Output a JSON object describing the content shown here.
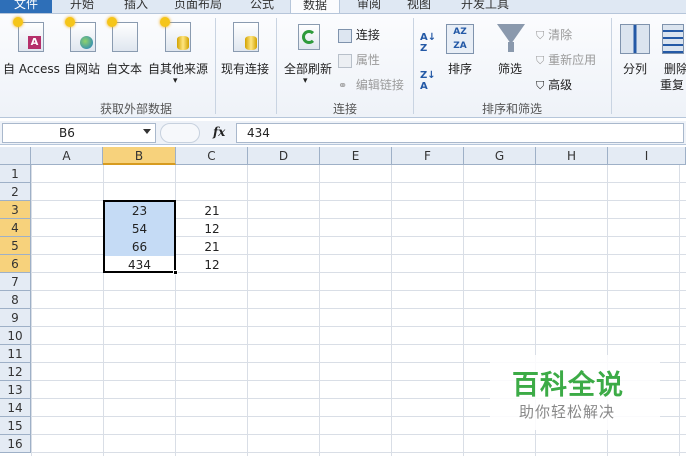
{
  "tabs": {
    "file": "文件",
    "home": "开始",
    "insert": "插入",
    "page_layout": "页面布局",
    "formulas": "公式",
    "data": "数据",
    "review": "审阅",
    "view": "视图",
    "developer": "开发工具"
  },
  "ribbon": {
    "access": "自 Access",
    "web": "自网站",
    "text": "自文本",
    "other": "自其他来源",
    "existing": "现有连接",
    "group_external": "获取外部数据",
    "refresh_all": "全部刷新",
    "connections": "连接",
    "properties": "属性",
    "edit_links": "编辑链接",
    "group_connections": "连接",
    "sort": "排序",
    "filter": "筛选",
    "clear": "清除",
    "reapply": "重新应用",
    "advanced": "高级",
    "group_sort_filter": "排序和筛选",
    "text_to_columns": "分列",
    "remove_dup_1": "删除",
    "remove_dup_2": "重复"
  },
  "formula_bar": {
    "name_box": "B6",
    "fx": "fx",
    "content": "434"
  },
  "columns": [
    "A",
    "B",
    "C",
    "D",
    "E",
    "F",
    "G",
    "H",
    "I"
  ],
  "rows": [
    "1",
    "2",
    "3",
    "4",
    "5",
    "6",
    "7",
    "8",
    "9",
    "10",
    "11",
    "12",
    "13",
    "14",
    "15",
    "16"
  ],
  "cells": {
    "b3": "23",
    "b4": "54",
    "b5": "66",
    "b6": "434",
    "c3": "21",
    "c4": "12",
    "c5": "21",
    "c6": "12"
  },
  "watermark": {
    "title": "百科全说",
    "subtitle": "助你轻松解决"
  },
  "colors": {
    "file_tab": "#2e6fb8",
    "header_selected": "#f7d27c",
    "cell_highlight": "#c5dbf5",
    "watermark_green": "#3cab46"
  }
}
